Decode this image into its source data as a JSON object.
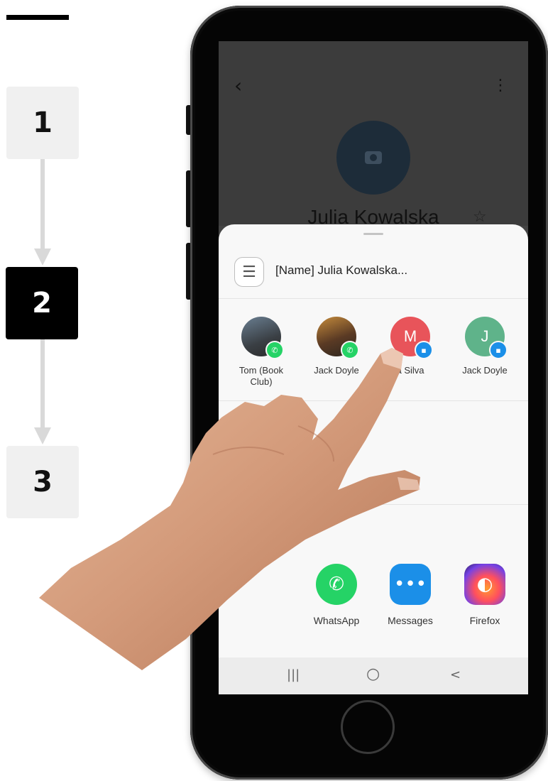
{
  "steps": [
    "1",
    "2",
    "3"
  ],
  "active_step": "2",
  "screen": {
    "back_icon": "back-arrow-icon",
    "more_icon": "more-options-icon",
    "contact_name": "Julia Kowalska",
    "share_text": "[Name] Julia Kowalska...",
    "contacts": [
      {
        "label_line1": "Tom (Book",
        "label_line2": "Club)",
        "badge": "whatsapp-badge-icon",
        "initial": ""
      },
      {
        "label_line1": "Jack Doyle",
        "label_line2": "",
        "badge": "whatsapp-badge-icon",
        "initial": ""
      },
      {
        "label_line1": "a Silva",
        "label_line2": "",
        "badge": "messages-badge-icon",
        "initial": "M"
      },
      {
        "label_line1": "Jack Doyle",
        "label_line2": "",
        "badge": "messages-badge-icon",
        "initial": "J"
      }
    ],
    "apps_row1": [
      {
        "label": "WhatsApp",
        "icon": "whatsapp-icon"
      },
      {
        "label": "Messages",
        "icon": "messages-icon"
      },
      {
        "label": "Firefox",
        "icon": "firefox-icon"
      }
    ],
    "apps_row2": [
      {
        "icon": "bluetooth-icon"
      },
      {
        "icon": "bluetooth-icon"
      },
      {
        "icon": "smart-switch-icon"
      },
      {
        "icon": "edge-icon"
      }
    ],
    "nav": {
      "recents": "|||",
      "home": "○",
      "back": "<"
    }
  },
  "colors": {
    "active_step_bg": "#000000",
    "step_bg": "#f0f0f0",
    "whatsapp": "#25d366",
    "messages": "#1b8fe8",
    "contact_m": "#e8545a",
    "contact_j": "#5fb38a"
  }
}
